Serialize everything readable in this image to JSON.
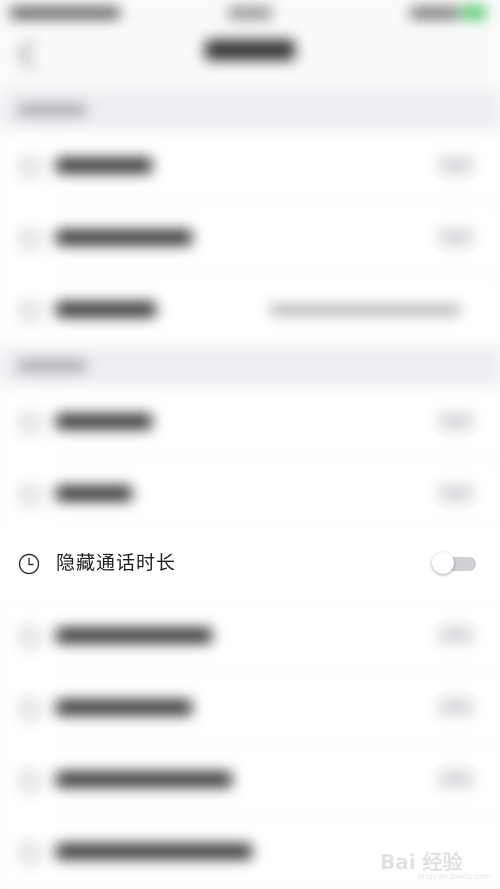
{
  "focused_setting": {
    "label": "隐藏通话时长",
    "icon": "clock-icon",
    "toggle_on": false
  },
  "colors": {
    "toggle_track_off": "#cfcfd4",
    "section_background": "#eeeef2",
    "text_primary": "#1f1f1f"
  },
  "watermark": {
    "text": "Bai 经验",
    "sub": "jingyan.baidu.com"
  }
}
